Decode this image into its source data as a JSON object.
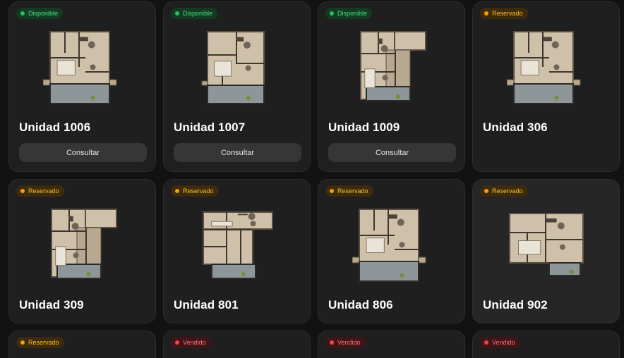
{
  "status_labels": {
    "available": "Disponible",
    "reserved": "Reservado",
    "sold": "Vendido"
  },
  "status_colors": {
    "available": "#22c55e",
    "reserved": "#f59e0b",
    "sold": "#ef4444"
  },
  "action_label": "Consultar",
  "units": [
    {
      "name": "Unidad 1006",
      "status": "Disponible",
      "status_key": "available",
      "action": "Consultar"
    },
    {
      "name": "Unidad 1007",
      "status": "Disponible",
      "status_key": "available",
      "action": "Consultar"
    },
    {
      "name": "Unidad 1009",
      "status": "Disponible",
      "status_key": "available",
      "action": "Consultar"
    },
    {
      "name": "Unidad 306",
      "status": "Reservado",
      "status_key": "reserved"
    },
    {
      "name": "Unidad 309",
      "status": "Reservado",
      "status_key": "reserved"
    },
    {
      "name": "Unidad 801",
      "status": "Reservado",
      "status_key": "reserved"
    },
    {
      "name": "Unidad 806",
      "status": "Reservado",
      "status_key": "reserved"
    },
    {
      "name": "Unidad 902",
      "status": "Reservado",
      "status_key": "reserved"
    },
    {
      "name": "",
      "status": "Reservado",
      "status_key": "reserved"
    },
    {
      "name": "",
      "status": "Vendido",
      "status_key": "sold"
    },
    {
      "name": "",
      "status": "Vendido",
      "status_key": "sold"
    },
    {
      "name": "",
      "status": "Vendido",
      "status_key": "sold"
    }
  ]
}
